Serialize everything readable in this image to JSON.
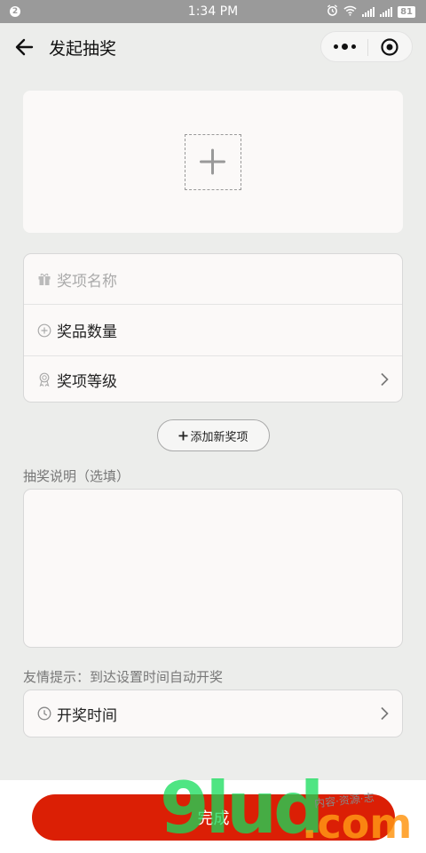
{
  "status": {
    "badge": "2",
    "time": "1:34 PM",
    "battery": "81"
  },
  "nav": {
    "title": "发起抽奖"
  },
  "prize": {
    "name_placeholder": "奖项名称",
    "quantity_label": "奖品数量",
    "level_label": "奖项等级"
  },
  "add_button": {
    "label": "添加新奖项"
  },
  "description": {
    "label": "抽奖说明（选填）"
  },
  "tip": {
    "text": "友情提示：到达设置时间自动开奖"
  },
  "draw_time": {
    "label": "开奖时间"
  },
  "footer": {
    "done_label": "完成"
  },
  "watermark": {
    "main": "9lud",
    "suffix": ".com",
    "note": "内容·资源·志"
  },
  "colors": {
    "primary": "#db1f05",
    "background": "#ecedeb",
    "card": "#fbf9f8"
  }
}
